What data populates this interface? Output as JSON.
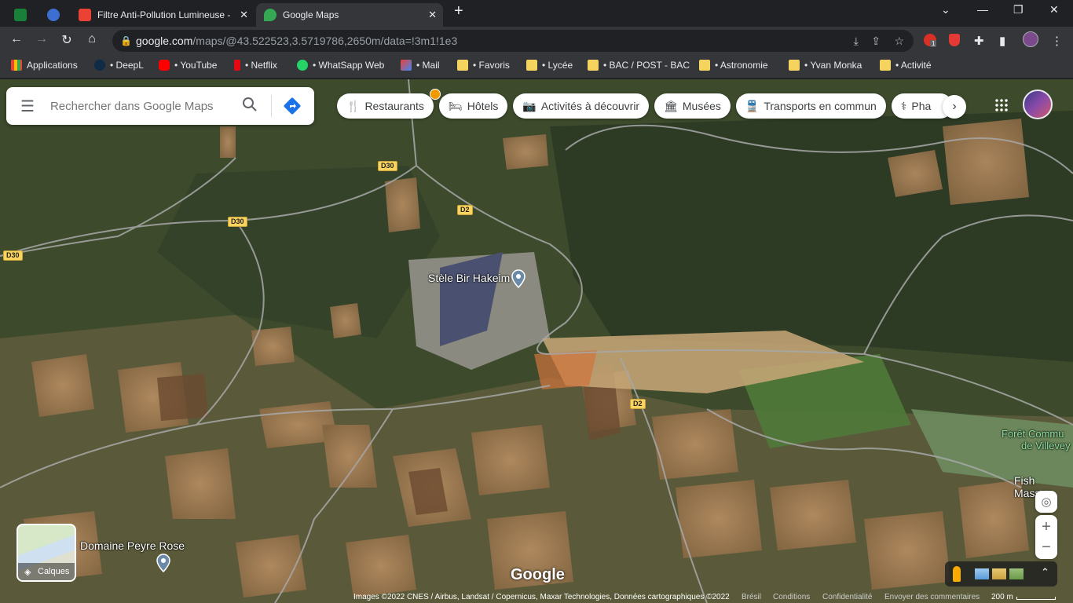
{
  "tabs": [
    {
      "label": "",
      "favicon_color": "#188038"
    },
    {
      "label": "",
      "favicon_color": "#3c6fd1"
    },
    {
      "label": "Filtre Anti-Pollution Lumineuse -",
      "favicon_color": "#ea4335"
    },
    {
      "label": "Google Maps",
      "favicon_color": "#34a853",
      "active": true
    }
  ],
  "new_tab": "+",
  "window_controls": {
    "minimize": "—",
    "restore": "❐",
    "close": "✕",
    "dropdown": "⌄"
  },
  "address": {
    "host": "google.com",
    "path": "/maps/@43.522523,3.5719786,2650m/data=!3m1!1e3"
  },
  "bookmarks": [
    {
      "label": "Applications",
      "icon": "apps-grid-icon"
    },
    {
      "label": "• DeepL",
      "icon": "deepl-icon"
    },
    {
      "label": "• YouTube",
      "icon": "youtube-icon"
    },
    {
      "label": "• Netflix",
      "icon": "netflix-icon"
    },
    {
      "label": "• WhatSapp Web",
      "icon": "whatsapp-icon"
    },
    {
      "label": "• Mail",
      "icon": "gmail-icon"
    },
    {
      "label": "• Favoris",
      "icon": "folder-icon"
    },
    {
      "label": "• Lycée",
      "icon": "folder-icon"
    },
    {
      "label": "• BAC / POST - BAC",
      "icon": "folder-icon"
    },
    {
      "label": "• Astronomie",
      "icon": "folder-icon"
    },
    {
      "label": "• Yvan Monka",
      "icon": "folder-icon"
    },
    {
      "label": "• Activité",
      "icon": "folder-icon"
    }
  ],
  "search": {
    "placeholder": "Rechercher dans Google Maps"
  },
  "chips": [
    {
      "label": "Restaurants",
      "icon": "🍴"
    },
    {
      "label": "Hôtels",
      "icon": "🛏"
    },
    {
      "label": "Activités à découvrir",
      "icon": "📷"
    },
    {
      "label": "Musées",
      "icon": "🏛"
    },
    {
      "label": "Transports en commun",
      "icon": "🚆"
    },
    {
      "label": "Pha",
      "icon": "⚕"
    }
  ],
  "map_labels": {
    "stele": "Stèle Bir Hakeim",
    "domaine": "Domaine Peyre Rose",
    "foret_1": "Forêt Commu",
    "foret_2": "de Villevey",
    "fish": "Fish Massag"
  },
  "road_labels": [
    "D30",
    "D30",
    "D30",
    "D2",
    "D2"
  ],
  "layers_label": "Calques",
  "google_logo": "Google",
  "attribution": {
    "images": "Images ©2022 CNES / Airbus, Landsat / Copernicus, Maxar Technologies, Données cartographiques ©2022",
    "bresil": "Brésil",
    "conditions": "Conditions",
    "confidentialite": "Confidentialité",
    "feedback": "Envoyer des commentaires",
    "scale": "200 m"
  },
  "extension_badge": "1"
}
